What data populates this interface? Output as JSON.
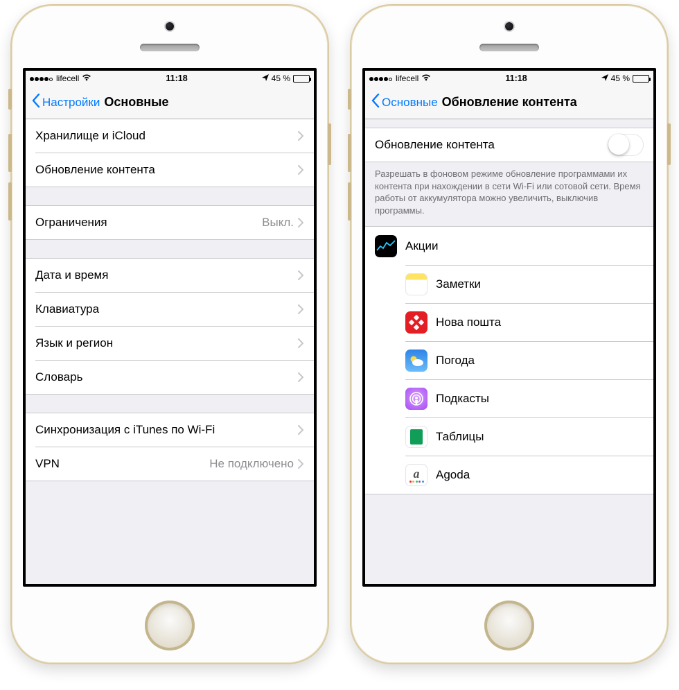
{
  "status": {
    "carrier": "lifecell",
    "time": "11:18",
    "battery_pct": "45 %"
  },
  "left": {
    "back": "Настройки",
    "title": "Основные",
    "g1": [
      {
        "label": "Хранилище и iCloud"
      },
      {
        "label": "Обновление контента"
      }
    ],
    "g2": [
      {
        "label": "Ограничения",
        "value": "Выкл."
      }
    ],
    "g3": [
      {
        "label": "Дата и время"
      },
      {
        "label": "Клавиатура"
      },
      {
        "label": "Язык и регион"
      },
      {
        "label": "Словарь"
      }
    ],
    "g4": [
      {
        "label": "Синхронизация с iTunes по Wi-Fi"
      },
      {
        "label": "VPN",
        "value": "Не подключено"
      }
    ]
  },
  "right": {
    "back": "Основные",
    "title": "Обновление контента",
    "master_label": "Обновление контента",
    "master_on": false,
    "footer": "Разрешать в фоновом режиме обновление программами их контента при нахождении в сети Wi-Fi или сотовой сети. Время работы от аккумулятора можно увеличить, выключив программы.",
    "apps": [
      {
        "label": "Акции",
        "icon": "stocks"
      },
      {
        "label": "Заметки",
        "icon": "notes"
      },
      {
        "label": "Нова пошта",
        "icon": "novaposhta"
      },
      {
        "label": "Погода",
        "icon": "weather"
      },
      {
        "label": "Подкасты",
        "icon": "podcasts"
      },
      {
        "label": "Таблицы",
        "icon": "sheets"
      },
      {
        "label": "Agoda",
        "icon": "agoda"
      }
    ]
  }
}
